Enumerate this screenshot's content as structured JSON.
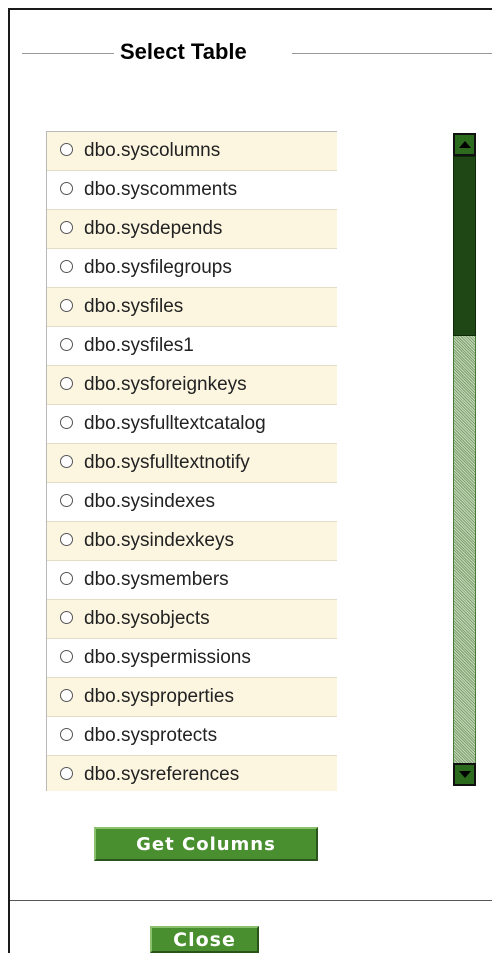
{
  "section": {
    "title": "Select Table"
  },
  "tables": [
    {
      "label": "dbo.syscolumns"
    },
    {
      "label": "dbo.syscomments"
    },
    {
      "label": "dbo.sysdepends"
    },
    {
      "label": "dbo.sysfilegroups"
    },
    {
      "label": "dbo.sysfiles"
    },
    {
      "label": "dbo.sysfiles1"
    },
    {
      "label": "dbo.sysforeignkeys"
    },
    {
      "label": "dbo.sysfulltextcatalog"
    },
    {
      "label": "dbo.sysfulltextnotify"
    },
    {
      "label": "dbo.sysindexes"
    },
    {
      "label": "dbo.sysindexkeys"
    },
    {
      "label": "dbo.sysmembers"
    },
    {
      "label": "dbo.sysobjects"
    },
    {
      "label": "dbo.syspermissions"
    },
    {
      "label": "dbo.sysproperties"
    },
    {
      "label": "dbo.sysprotects"
    },
    {
      "label": "dbo.sysreferences"
    }
  ],
  "buttons": {
    "get_columns": "Get Columns",
    "close": "Close"
  },
  "colors": {
    "button_green": "#4a8f2f",
    "scroll_thumb": "#1f4715",
    "row_alt": "#fcf6e1"
  },
  "icons": {
    "scroll_up": "triangle-up-icon",
    "scroll_down": "triangle-down-icon",
    "radio": "radio-button-icon"
  }
}
